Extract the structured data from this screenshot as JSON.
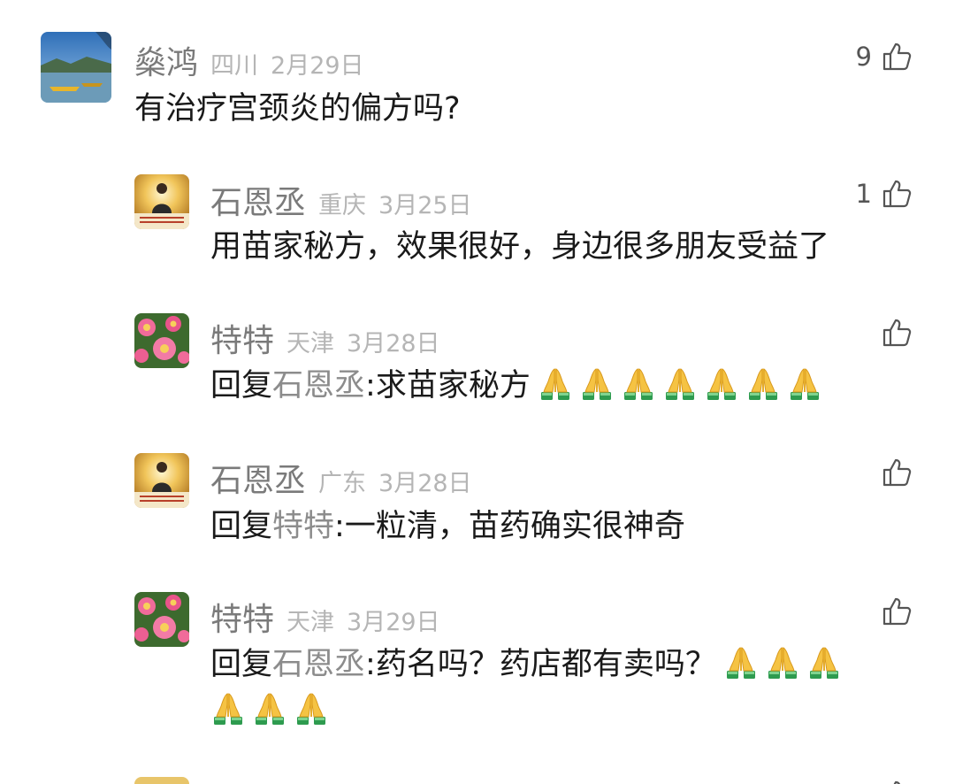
{
  "comments": [
    {
      "author": "燊鸿",
      "location": "四川",
      "date": "2月29日",
      "likes": "9",
      "text": "有治疗宫颈炎的偏方吗?",
      "avatar": "lake-boat-avatar"
    },
    {
      "author": "石恩丞",
      "location": "重庆",
      "date": "3月25日",
      "likes": "1",
      "text": "用苗家秘方，效果很好，身边很多朋友受益了",
      "avatar": "golden-portrait-avatar"
    },
    {
      "author": "特特",
      "location": "天津",
      "date": "3月28日",
      "likes": "",
      "reply_prefix": "回复",
      "reply_to": "石恩丞",
      "text": ":求苗家秘方",
      "emoji_count": 7,
      "avatar": "pink-flowers-avatar"
    },
    {
      "author": "石恩丞",
      "location": "广东",
      "date": "3月28日",
      "likes": "",
      "reply_prefix": "回复",
      "reply_to": "特特",
      "text": ":一粒清，苗药确实很神奇",
      "avatar": "golden-portrait-avatar"
    },
    {
      "author": "特特",
      "location": "天津",
      "date": "3月29日",
      "likes": "",
      "reply_prefix": "回复",
      "reply_to": "石恩丞",
      "text": ":药名吗？药店都有卖吗？",
      "emoji_count_line1": 3,
      "emoji_count_line2": 3,
      "avatar": "pink-flowers-avatar"
    }
  ],
  "icons": {
    "like": "thumbs-up-icon",
    "emoji": "folded-hands-emoji"
  },
  "colors": {
    "author": "#7a7a7a",
    "meta": "#b5b5b5",
    "text": "#1a1a1a",
    "reply_target": "#8c8c8c"
  }
}
